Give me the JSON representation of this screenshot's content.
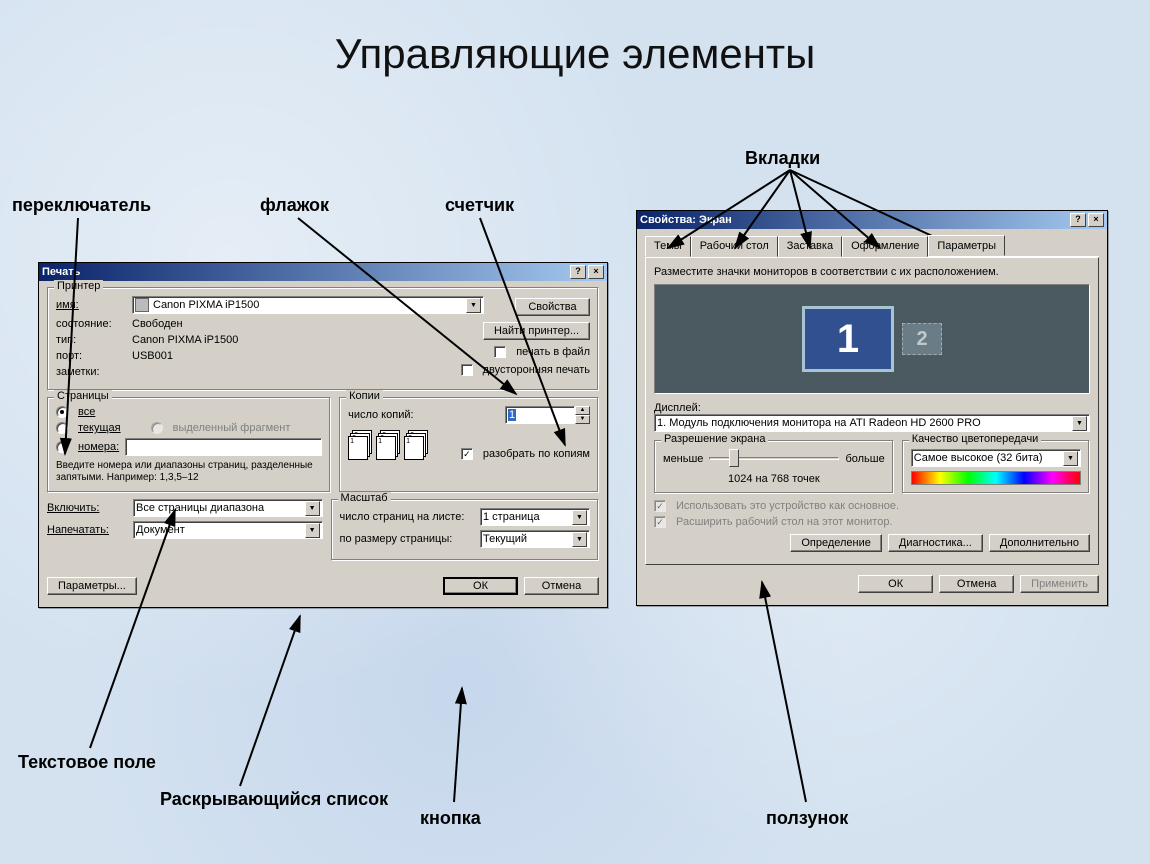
{
  "slide": {
    "title": "Управляющие элементы"
  },
  "annotations": {
    "radio": "переключатель",
    "checkbox": "флажок",
    "spinner": "счетчик",
    "tabs": "Вкладки",
    "textfield": "Текстовое поле",
    "dropdown": "Раскрывающийся список",
    "button_annot": "кнопка",
    "slider": "ползунок"
  },
  "print": {
    "title": "Печать",
    "printer_group": "Принтер",
    "name_label": "имя:",
    "name_value": "Canon PIXMA iP1500",
    "state_label": "состояние:",
    "state_value": "Свободен",
    "type_label": "тип:",
    "type_value": "Canon PIXMA iP1500",
    "port_label": "порт:",
    "port_value": "USB001",
    "notes_label": "заметки:",
    "properties_btn": "Свойства",
    "find_btn": "Найти принтер...",
    "print_to_file": "печать в файл",
    "duplex": "двусторонняя печать",
    "pages_group": "Страницы",
    "pages_all": "все",
    "pages_current": "текущая",
    "pages_selection": "выделенный фрагмент",
    "pages_numbers": "номера:",
    "pages_hint": "Введите номера или диапазоны страниц, разделенные запятыми. Например: 1,3,5–12",
    "copies_group": "Копии",
    "copies_label": "число копий:",
    "copies_value": "1",
    "collate": "разобрать по копиям",
    "include_label": "Включить:",
    "include_value": "Все страницы диапазона",
    "print_what_label": "Напечатать:",
    "print_what_value": "Документ",
    "zoom_group": "Масштаб",
    "pages_per_sheet_label": "число страниц на листе:",
    "pages_per_sheet_value": "1 страница",
    "scale_label": "по размеру страницы:",
    "scale_value": "Текущий",
    "options_btn": "Параметры...",
    "ok_btn": "ОК",
    "cancel_btn": "Отмена"
  },
  "display": {
    "title": "Свойства: Экран",
    "tabs": {
      "themes": "Темы",
      "desktop": "Рабочий стол",
      "screensaver": "Заставка",
      "appearance": "Оформление",
      "settings": "Параметры"
    },
    "instruction": "Разместите значки мониторов в соответствии с их расположением.",
    "monitor1": "1",
    "monitor2": "2",
    "display_label": "Дисплей:",
    "display_value": "1. Модуль подключения монитора на ATI Radeon HD 2600 PRO",
    "resolution_group": "Разрешение экрана",
    "less": "меньше",
    "more": "больше",
    "resolution_value": "1024 на 768 точек",
    "color_group": "Качество цветопередачи",
    "color_value": "Самое высокое (32 бита)",
    "use_primary": "Использовать это устройство как основное.",
    "extend": "Расширить рабочий стол на этот монитор.",
    "identify_btn": "Определение",
    "troubleshoot_btn": "Диагностика...",
    "advanced_btn": "Дополнительно",
    "ok_btn": "ОК",
    "cancel_btn": "Отмена",
    "apply_btn": "Применить"
  }
}
